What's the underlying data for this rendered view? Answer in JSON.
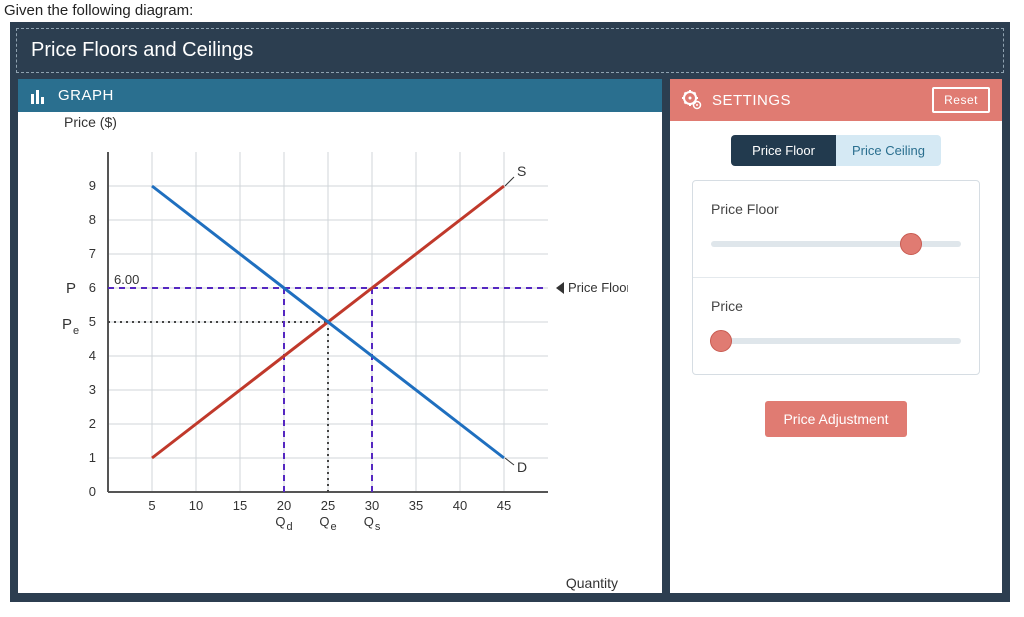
{
  "prompt_text": "Given the following diagram:",
  "title": "Price Floors and Ceilings",
  "panels": {
    "graph": {
      "header_label": "GRAPH",
      "y_title": "Price ($)",
      "x_title": "Quantity",
      "price_floor_label": "Price Floor",
      "S_label": "S",
      "D_label": "D",
      "P_label": "P",
      "Pe_label": "P",
      "Pe_sub": "e",
      "Qd_label": "Q",
      "Qd_sub": "d",
      "Qe_label": "Q",
      "Qe_sub": "e",
      "Qs_label": "Q",
      "Qs_sub": "s",
      "P_value_text": "6.00"
    },
    "settings": {
      "header_label": "SETTINGS",
      "reset_label": "Reset",
      "mode": {
        "floor": "Price Floor",
        "ceiling": "Price Ceiling"
      },
      "ctrl_floor_label": "Price Floor",
      "ctrl_price_label": "Price",
      "adjust_label": "Price Adjustment",
      "floor_slider_pct": 80,
      "price_slider_pct": 4
    }
  },
  "chart_data": {
    "type": "line",
    "title": "Price Floors and Ceilings",
    "xlabel": "Quantity",
    "ylabel": "Price ($)",
    "xlim": [
      0,
      50
    ],
    "ylim": [
      0,
      10
    ],
    "x_ticks": [
      5,
      10,
      15,
      20,
      25,
      30,
      35,
      40,
      45
    ],
    "y_ticks": [
      0,
      1,
      2,
      3,
      4,
      5,
      6,
      7,
      8,
      9
    ],
    "series": [
      {
        "name": "S",
        "points": [
          [
            5,
            1
          ],
          [
            45,
            9
          ]
        ]
      },
      {
        "name": "D",
        "points": [
          [
            5,
            9
          ],
          [
            45,
            1
          ]
        ]
      }
    ],
    "equilibrium": {
      "Qe": 25,
      "Pe": 5
    },
    "price_floor": {
      "P": 6.0,
      "Qd": 20,
      "Qs": 30
    }
  }
}
